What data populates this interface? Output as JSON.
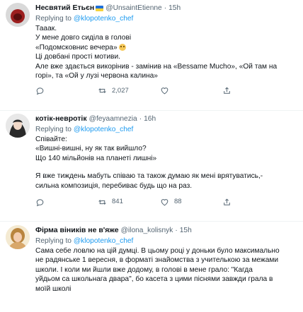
{
  "tweets": [
    {
      "name": "Несвятий Етьєн",
      "handle": "@UnsaintEtienne",
      "dot": "·",
      "time": "15h",
      "reply_prefix": "Replying to ",
      "reply_to": "@klopotenko_chef",
      "lines": [
        "Тааак.",
        "У мене довго сиділа в голові",
        "«Подомсковнис вечера»",
        "Ці довбані прості мотиви.",
        "Але вже здається викорінив - замінив на «Bessame Mucho», «Ой там на",
        "горі», та «Ой у лузі червона калина»"
      ],
      "actions": {
        "replies": "",
        "retweets": "2,027",
        "likes": "",
        "share": ""
      }
    },
    {
      "name": "котік-невротік",
      "handle": "@feyaamnezia",
      "dot": "·",
      "time": "16h",
      "reply_prefix": "Replying to ",
      "reply_to": "@klopotenko_chef",
      "lines": [
        "Співайте:",
        "«Вишні-вишні, ну як так вийшло?",
        "Що 140 мільйонів на планеті лишні»",
        "",
        "Я вже тиждень мабуть співаю та також думаю як мені врятуватись,-",
        "сильна композиція, перебиває будь що на раз."
      ],
      "actions": {
        "replies": "",
        "retweets": "841",
        "likes": "88",
        "share": ""
      }
    },
    {
      "name": "Фірма віників не в'яже",
      "handle": "@ilona_kolisnyk",
      "dot": "·",
      "time": "15h",
      "reply_prefix": "Replying to ",
      "reply_to": "@klopotenko_chef",
      "lines": [
        "Сама себе ловлю на цій думці. В цьому році у доньки було максимально",
        "не радянське 1 вересня, в форматі знайомства з учителькою за межами",
        "школи. І коли ми йшли вже додому, в голові в мене грало: \"Кагда",
        "уйдьом са школьнага двара\", бо касета з цими піснями завжди грала в",
        "моїй школі"
      ]
    }
  ]
}
